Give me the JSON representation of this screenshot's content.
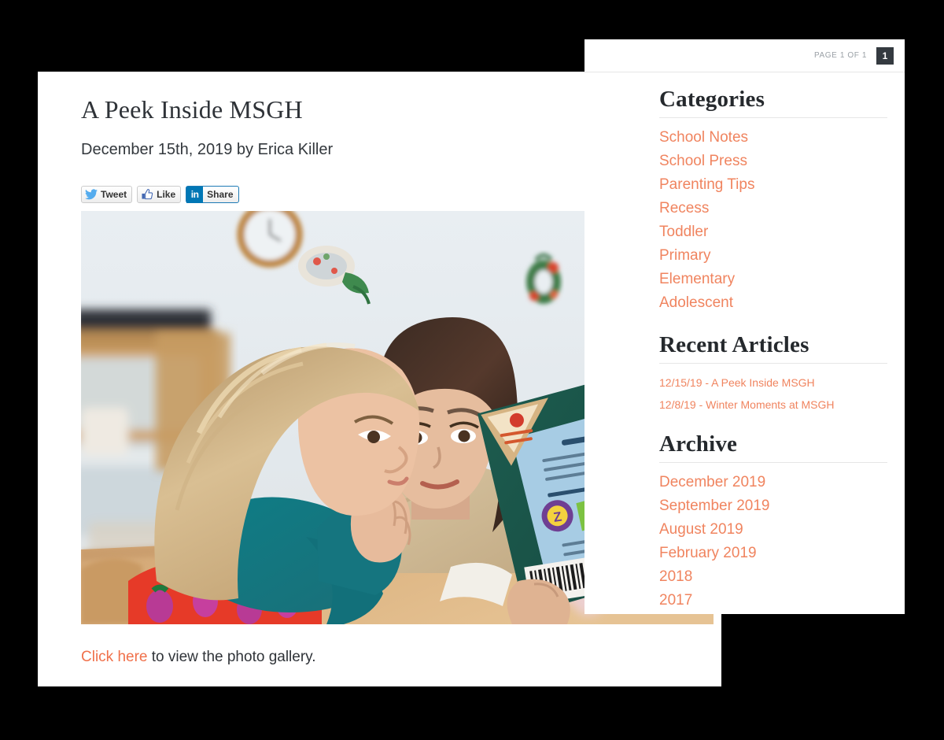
{
  "article": {
    "title": "A Peek Inside MSGH",
    "byline": "December 15th, 2019 by Erica Killer",
    "share": [
      {
        "network": "twitter",
        "label": "Tweet",
        "icon": "twitter-bird-icon"
      },
      {
        "network": "facebook",
        "label": "Like",
        "icon": "thumbs-up-icon"
      },
      {
        "network": "linkedin",
        "label": "Share",
        "icon": "linkedin-in-icon"
      }
    ],
    "photo": {
      "alt": "Two young girls sitting at a wooden classroom table reading a green book together",
      "description": "Classroom scene: blonde girl in teal long-sleeve shirt and red strawberry-print dress resting her chin on her hand, next to a dark-haired girl in a cream fleece sweater holding up a dark green hardcover book with a light blue back-cover panel"
    },
    "gallery": {
      "link_text": "Click here",
      "rest_text": " to view the photo gallery."
    }
  },
  "sidebar": {
    "pager": {
      "label": "PAGE 1 OF 1",
      "current_page": "1"
    },
    "categories": {
      "heading": "Categories",
      "items": [
        {
          "label": "School Notes"
        },
        {
          "label": "School Press"
        },
        {
          "label": "Parenting Tips"
        },
        {
          "label": "Recess"
        },
        {
          "label": "Toddler"
        },
        {
          "label": "Primary"
        },
        {
          "label": "Elementary"
        },
        {
          "label": "Adolescent"
        }
      ]
    },
    "recent": {
      "heading": "Recent Articles",
      "items": [
        {
          "label": "12/15/19 - A Peek Inside MSGH"
        },
        {
          "label": "12/8/19 - Winter Moments at MSGH"
        }
      ]
    },
    "archive": {
      "heading": "Archive",
      "items": [
        {
          "label": "December 2019"
        },
        {
          "label": "September 2019"
        },
        {
          "label": "August 2019"
        },
        {
          "label": "February 2019"
        },
        {
          "label": "2018"
        },
        {
          "label": "2017"
        }
      ]
    }
  },
  "colors": {
    "accent_orange": "#f0845f",
    "link_orange": "#f0704a",
    "heading_dark": "#25292d",
    "text_dark": "#2f3338",
    "pager_box": "#343a40",
    "page_background": "#000000",
    "card_background": "#ffffff"
  }
}
